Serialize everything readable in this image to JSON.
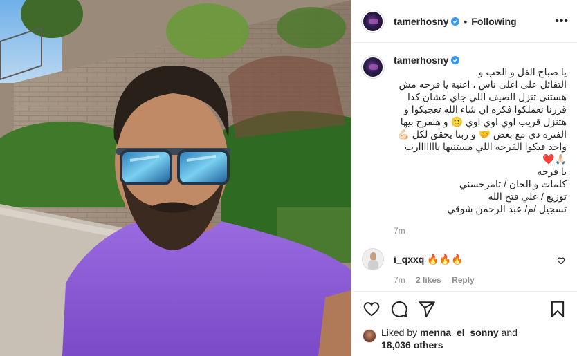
{
  "post": {
    "username": "tamerhosny",
    "separator": "•",
    "follow_status": "Following",
    "more_label": "•••"
  },
  "caption": {
    "username": "tamerhosny",
    "text": "يا صباح الفل و الحب و\nالتفائل على اغلى ناس ، اغنية يا فرحه مش\nهستنى تنزل الصيف اللي جاي عشان كدا\nقررنا نعملكوا فكره ان شاء الله تعجبكوا و\nهتنزل قريب اوي اوي اوي 🙂 و هنفرح بيها\nالفتره دي مع بعض 🤝 و ربنا يحقق لكل 💪🏻\nواحد فيكوا الفرحه اللي مستنيها يااااااارب\n🙏🏻❤️\nيا فرحه\nكلمات و الحان / تامرحسني\nتوزيع / علي فتح الله\nتسجيل /م/ عبد الرحمن شوقي",
    "time": "7m"
  },
  "comments": [
    {
      "username": "i_qxxq",
      "text": "🔥🔥🔥",
      "time": "7m",
      "likes": "2 likes",
      "reply_label": "Reply"
    }
  ],
  "likes": {
    "prefix": "Liked by",
    "user": "menna_el_sonny",
    "and": "and",
    "others": "18,036 others"
  },
  "colors": {
    "verified": "#3897f0",
    "text": "#262626",
    "secondary": "#8e8e8e",
    "shirt": "#8a5ad8"
  },
  "icons": [
    "verified-icon",
    "heart-icon",
    "comment-icon",
    "share-icon",
    "bookmark-icon"
  ]
}
